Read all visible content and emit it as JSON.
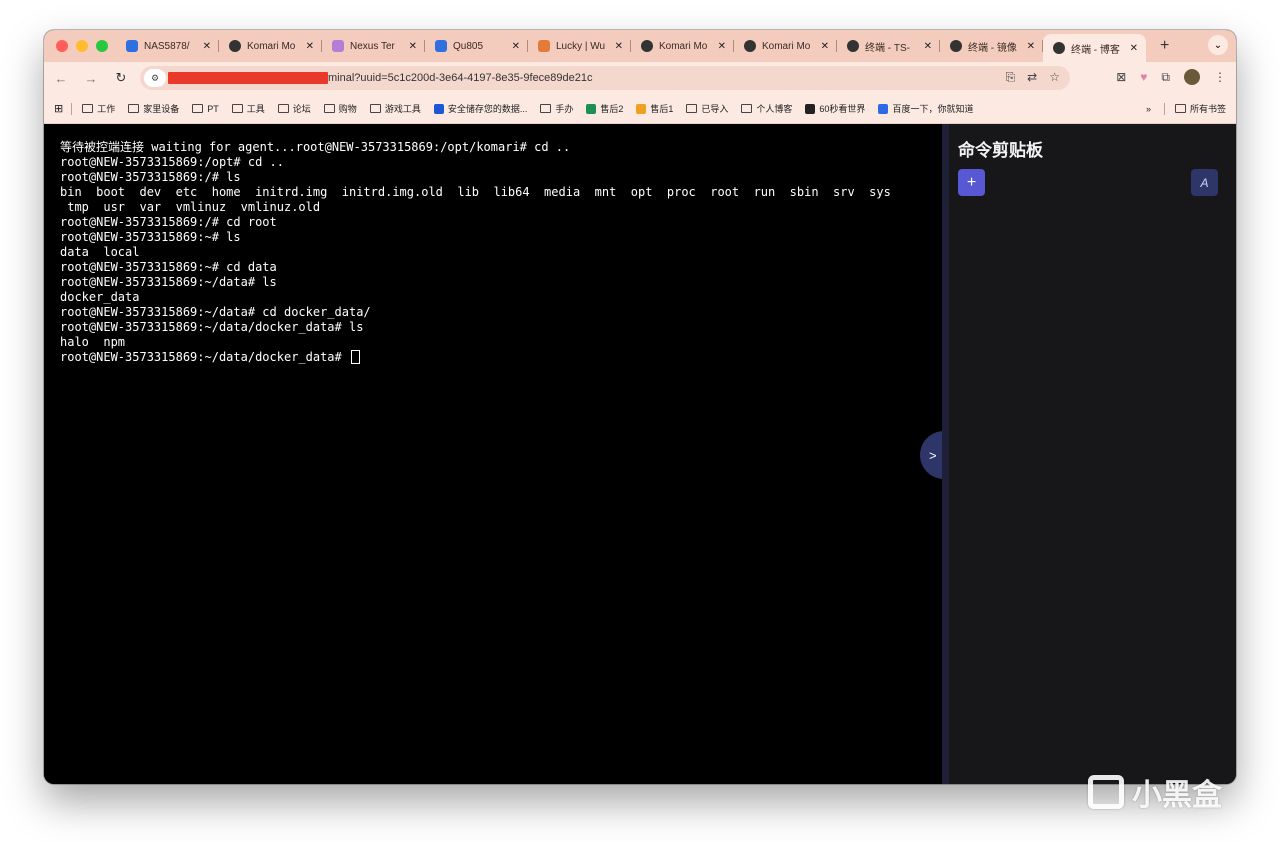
{
  "tabs": [
    {
      "title": "NAS5878/",
      "icon": "nas-icon",
      "color": "#2f6fe0",
      "active": false
    },
    {
      "title": "Komari Mo",
      "icon": "komari-icon",
      "color": "#333333",
      "active": false
    },
    {
      "title": "Nexus Ter",
      "icon": "star-icon",
      "color": "#b37fd6",
      "active": false
    },
    {
      "title": "Qu805",
      "icon": "nas-icon",
      "color": "#2f6fe0",
      "active": false
    },
    {
      "title": "Lucky | Wu",
      "icon": "lucky-icon",
      "color": "#e27b3a",
      "active": false
    },
    {
      "title": "Komari Mo",
      "icon": "komari-icon",
      "color": "#333333",
      "active": false
    },
    {
      "title": "Komari Mo",
      "icon": "komari-icon",
      "color": "#333333",
      "active": false
    },
    {
      "title": "终端 - TS-",
      "icon": "komari-icon",
      "color": "#333333",
      "active": false
    },
    {
      "title": "终端 - 镜像",
      "icon": "komari-icon",
      "color": "#333333",
      "active": false
    },
    {
      "title": "终端 - 博客",
      "icon": "komari-icon",
      "color": "#333333",
      "active": true
    }
  ],
  "url": {
    "suffix": "minal?uuid=5c1c200d-3e64-4197-8e35-9fece89de21c"
  },
  "bookmarks": [
    {
      "label": "工作",
      "type": "folder"
    },
    {
      "label": "家里设备",
      "type": "folder"
    },
    {
      "label": "PT",
      "type": "folder"
    },
    {
      "label": "工具",
      "type": "folder"
    },
    {
      "label": "论坛",
      "type": "folder"
    },
    {
      "label": "购物",
      "type": "folder"
    },
    {
      "label": "游戏工具",
      "type": "folder"
    },
    {
      "label": "安全储存您的数据...",
      "type": "site",
      "color": "#1a56d6"
    },
    {
      "label": "手办",
      "type": "folder"
    },
    {
      "label": "售后2",
      "type": "site",
      "color": "#1c8f55"
    },
    {
      "label": "售后1",
      "type": "site",
      "color": "#f0a020"
    },
    {
      "label": "已导入",
      "type": "folder"
    },
    {
      "label": "个人博客",
      "type": "folder"
    },
    {
      "label": "60秒看世界",
      "type": "site",
      "color": "#222222"
    },
    {
      "label": "百度一下，你就知道",
      "type": "site",
      "color": "#2d6be4"
    }
  ],
  "bookmarks_more": "»",
  "bookmarks_all": "所有书签",
  "terminal": {
    "lines": [
      "等待被控端连接 waiting for agent...root@NEW-3573315869:/opt/komari# cd ..",
      "root@NEW-3573315869:/opt# cd ..",
      "root@NEW-3573315869:/# ls",
      "bin  boot  dev  etc  home  initrd.img  initrd.img.old  lib  lib64  media  mnt  opt  proc  root  run  sbin  srv  sys",
      " tmp  usr  var  vmlinuz  vmlinuz.old",
      "root@NEW-3573315869:/# cd root",
      "root@NEW-3573315869:~# ls",
      "data  local",
      "root@NEW-3573315869:~# cd data",
      "root@NEW-3573315869:~/data# ls",
      "docker_data",
      "root@NEW-3573315869:~/data# cd docker_data/",
      "root@NEW-3573315869:~/data/docker_data# ls",
      "halo  npm"
    ],
    "prompt": "root@NEW-3573315869:~/data/docker_data# "
  },
  "drawer_toggle_label": ">",
  "panel": {
    "title": "命令剪贴板",
    "add_label": "+",
    "ai_label": "A"
  },
  "watermark": {
    "text": "小黑盒"
  }
}
